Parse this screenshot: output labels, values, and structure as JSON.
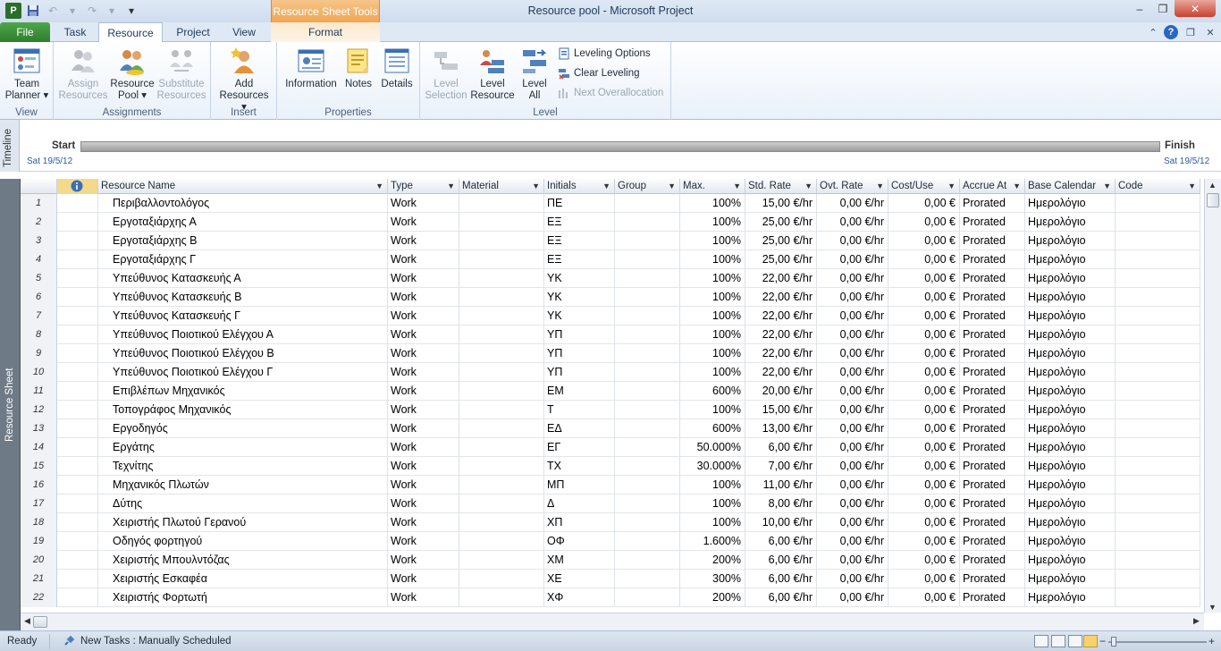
{
  "window": {
    "title": "Resource pool  -  Microsoft Project",
    "context_tab_header": "Resource Sheet Tools",
    "qat_logo": "P",
    "controls": {
      "minimize": "–",
      "maximize": "❐",
      "close": "✕"
    }
  },
  "tabs": {
    "file": "File",
    "task": "Task",
    "resource": "Resource",
    "project": "Project",
    "view": "View",
    "format": "Format"
  },
  "ribbon": {
    "groups": {
      "view": "View",
      "assignments": "Assignments",
      "insert": "Insert",
      "properties": "Properties",
      "level": "Level"
    },
    "buttons": {
      "team_planner_1": "Team",
      "team_planner_2": "Planner ▾",
      "assign_1": "Assign",
      "assign_2": "Resources",
      "resource_pool_1": "Resource",
      "resource_pool_2": "Pool ▾",
      "substitute_1": "Substitute",
      "substitute_2": "Resources",
      "add_1": "Add",
      "add_2": "Resources ▾",
      "information": "Information",
      "notes": "Notes",
      "details": "Details",
      "level_selection_1": "Level",
      "level_selection_2": "Selection",
      "level_resource_1": "Level",
      "level_resource_2": "Resource",
      "level_all_1": "Level",
      "level_all_2": "All",
      "leveling_options": "Leveling Options",
      "clear_leveling": "Clear Leveling",
      "next_overallocation": "Next Overallocation"
    }
  },
  "timeline": {
    "label": "Timeline",
    "start": "Start",
    "start_date": "Sat 19/5/12",
    "finish": "Finish",
    "finish_date": "Sat 19/5/12"
  },
  "sheet": {
    "label": "Resource Sheet",
    "headers": {
      "name": "Resource Name",
      "type": "Type",
      "material": "Material",
      "initials": "Initials",
      "group": "Group",
      "max": "Max.",
      "std_rate": "Std. Rate",
      "ovt_rate": "Ovt. Rate",
      "cost_use": "Cost/Use",
      "accrue_at": "Accrue At",
      "base_calendar": "Base Calendar",
      "code": "Code"
    },
    "rows": [
      {
        "id": "1",
        "name": "Περιβαλλοντολόγος",
        "type": "Work",
        "material": "",
        "initials": "ΠΕ",
        "group": "",
        "max": "100%",
        "std_rate": "15,00 €/hr",
        "ovt_rate": "0,00 €/hr",
        "cost_use": "0,00 €",
        "accrue": "Prorated",
        "calendar": "Ημερολόγιο",
        "code": ""
      },
      {
        "id": "2",
        "name": "Εργοταξιάρχης Α",
        "type": "Work",
        "material": "",
        "initials": "ΕΞ",
        "group": "",
        "max": "100%",
        "std_rate": "25,00 €/hr",
        "ovt_rate": "0,00 €/hr",
        "cost_use": "0,00 €",
        "accrue": "Prorated",
        "calendar": "Ημερολόγιο",
        "code": ""
      },
      {
        "id": "3",
        "name": "Εργοταξιάρχης Β",
        "type": "Work",
        "material": "",
        "initials": "ΕΞ",
        "group": "",
        "max": "100%",
        "std_rate": "25,00 €/hr",
        "ovt_rate": "0,00 €/hr",
        "cost_use": "0,00 €",
        "accrue": "Prorated",
        "calendar": "Ημερολόγιο",
        "code": ""
      },
      {
        "id": "4",
        "name": "Εργοταξιάρχης Γ",
        "type": "Work",
        "material": "",
        "initials": "ΕΞ",
        "group": "",
        "max": "100%",
        "std_rate": "25,00 €/hr",
        "ovt_rate": "0,00 €/hr",
        "cost_use": "0,00 €",
        "accrue": "Prorated",
        "calendar": "Ημερολόγιο",
        "code": ""
      },
      {
        "id": "5",
        "name": "Υπεύθυνος Κατασκευής Α",
        "type": "Work",
        "material": "",
        "initials": "ΥΚ",
        "group": "",
        "max": "100%",
        "std_rate": "22,00 €/hr",
        "ovt_rate": "0,00 €/hr",
        "cost_use": "0,00 €",
        "accrue": "Prorated",
        "calendar": "Ημερολόγιο",
        "code": ""
      },
      {
        "id": "6",
        "name": "Υπεύθυνος Κατασκευής Β",
        "type": "Work",
        "material": "",
        "initials": "ΥΚ",
        "group": "",
        "max": "100%",
        "std_rate": "22,00 €/hr",
        "ovt_rate": "0,00 €/hr",
        "cost_use": "0,00 €",
        "accrue": "Prorated",
        "calendar": "Ημερολόγιο",
        "code": ""
      },
      {
        "id": "7",
        "name": "Υπεύθυνος Κατασκευής Γ",
        "type": "Work",
        "material": "",
        "initials": "ΥΚ",
        "group": "",
        "max": "100%",
        "std_rate": "22,00 €/hr",
        "ovt_rate": "0,00 €/hr",
        "cost_use": "0,00 €",
        "accrue": "Prorated",
        "calendar": "Ημερολόγιο",
        "code": ""
      },
      {
        "id": "8",
        "name": "Υπεύθυνος Ποιοτικού Ελέγχου Α",
        "type": "Work",
        "material": "",
        "initials": "ΥΠ",
        "group": "",
        "max": "100%",
        "std_rate": "22,00 €/hr",
        "ovt_rate": "0,00 €/hr",
        "cost_use": "0,00 €",
        "accrue": "Prorated",
        "calendar": "Ημερολόγιο",
        "code": ""
      },
      {
        "id": "9",
        "name": "Υπεύθυνος Ποιοτικού Ελέγχου Β",
        "type": "Work",
        "material": "",
        "initials": "ΥΠ",
        "group": "",
        "max": "100%",
        "std_rate": "22,00 €/hr",
        "ovt_rate": "0,00 €/hr",
        "cost_use": "0,00 €",
        "accrue": "Prorated",
        "calendar": "Ημερολόγιο",
        "code": ""
      },
      {
        "id": "10",
        "name": "Υπεύθυνος Ποιοτικού Ελέγχου Γ",
        "type": "Work",
        "material": "",
        "initials": "ΥΠ",
        "group": "",
        "max": "100%",
        "std_rate": "22,00 €/hr",
        "ovt_rate": "0,00 €/hr",
        "cost_use": "0,00 €",
        "accrue": "Prorated",
        "calendar": "Ημερολόγιο",
        "code": ""
      },
      {
        "id": "11",
        "name": "Επιβλέπων Μηχανικός",
        "type": "Work",
        "material": "",
        "initials": "ΕΜ",
        "group": "",
        "max": "600%",
        "std_rate": "20,00 €/hr",
        "ovt_rate": "0,00 €/hr",
        "cost_use": "0,00 €",
        "accrue": "Prorated",
        "calendar": "Ημερολόγιο",
        "code": ""
      },
      {
        "id": "12",
        "name": "Τοπογράφος Μηχανικός",
        "type": "Work",
        "material": "",
        "initials": "Τ",
        "group": "",
        "max": "100%",
        "std_rate": "15,00 €/hr",
        "ovt_rate": "0,00 €/hr",
        "cost_use": "0,00 €",
        "accrue": "Prorated",
        "calendar": "Ημερολόγιο",
        "code": ""
      },
      {
        "id": "13",
        "name": "Εργοδηγός",
        "type": "Work",
        "material": "",
        "initials": "ΕΔ",
        "group": "",
        "max": "600%",
        "std_rate": "13,00 €/hr",
        "ovt_rate": "0,00 €/hr",
        "cost_use": "0,00 €",
        "accrue": "Prorated",
        "calendar": "Ημερολόγιο",
        "code": ""
      },
      {
        "id": "14",
        "name": "Εργάτης",
        "type": "Work",
        "material": "",
        "initials": "ΕΓ",
        "group": "",
        "max": "50.000%",
        "std_rate": "6,00 €/hr",
        "ovt_rate": "0,00 €/hr",
        "cost_use": "0,00 €",
        "accrue": "Prorated",
        "calendar": "Ημερολόγιο",
        "code": ""
      },
      {
        "id": "15",
        "name": "Τεχνίτης",
        "type": "Work",
        "material": "",
        "initials": "ΤΧ",
        "group": "",
        "max": "30.000%",
        "std_rate": "7,00 €/hr",
        "ovt_rate": "0,00 €/hr",
        "cost_use": "0,00 €",
        "accrue": "Prorated",
        "calendar": "Ημερολόγιο",
        "code": ""
      },
      {
        "id": "16",
        "name": "Μηχανικός Πλωτών",
        "type": "Work",
        "material": "",
        "initials": "ΜΠ",
        "group": "",
        "max": "100%",
        "std_rate": "11,00 €/hr",
        "ovt_rate": "0,00 €/hr",
        "cost_use": "0,00 €",
        "accrue": "Prorated",
        "calendar": "Ημερολόγιο",
        "code": ""
      },
      {
        "id": "17",
        "name": "Δύτης",
        "type": "Work",
        "material": "",
        "initials": "Δ",
        "group": "",
        "max": "100%",
        "std_rate": "8,00 €/hr",
        "ovt_rate": "0,00 €/hr",
        "cost_use": "0,00 €",
        "accrue": "Prorated",
        "calendar": "Ημερολόγιο",
        "code": ""
      },
      {
        "id": "18",
        "name": "Χειριστής Πλωτού Γερανού",
        "type": "Work",
        "material": "",
        "initials": "ΧΠ",
        "group": "",
        "max": "100%",
        "std_rate": "10,00 €/hr",
        "ovt_rate": "0,00 €/hr",
        "cost_use": "0,00 €",
        "accrue": "Prorated",
        "calendar": "Ημερολόγιο",
        "code": ""
      },
      {
        "id": "19",
        "name": "Οδηγός φορτηγού",
        "type": "Work",
        "material": "",
        "initials": "ΟΦ",
        "group": "",
        "max": "1.600%",
        "std_rate": "6,00 €/hr",
        "ovt_rate": "0,00 €/hr",
        "cost_use": "0,00 €",
        "accrue": "Prorated",
        "calendar": "Ημερολόγιο",
        "code": ""
      },
      {
        "id": "20",
        "name": "Χειριστής Μπουλντόζας",
        "type": "Work",
        "material": "",
        "initials": "ΧΜ",
        "group": "",
        "max": "200%",
        "std_rate": "6,00 €/hr",
        "ovt_rate": "0,00 €/hr",
        "cost_use": "0,00 €",
        "accrue": "Prorated",
        "calendar": "Ημερολόγιο",
        "code": ""
      },
      {
        "id": "21",
        "name": "Χειριστής Εσκαφέα",
        "type": "Work",
        "material": "",
        "initials": "ΧΕ",
        "group": "",
        "max": "300%",
        "std_rate": "6,00 €/hr",
        "ovt_rate": "0,00 €/hr",
        "cost_use": "0,00 €",
        "accrue": "Prorated",
        "calendar": "Ημερολόγιο",
        "code": ""
      },
      {
        "id": "22",
        "name": "Χειριστής Φορτωτή",
        "type": "Work",
        "material": "",
        "initials": "ΧΦ",
        "group": "",
        "max": "200%",
        "std_rate": "6,00 €/hr",
        "ovt_rate": "0,00 €/hr",
        "cost_use": "0,00 €",
        "accrue": "Prorated",
        "calendar": "Ημερολόγιο",
        "code": ""
      }
    ]
  },
  "statusbar": {
    "ready": "Ready",
    "new_tasks": "New Tasks : Manually Scheduled",
    "zoom_minus": "−",
    "zoom_plus": "+"
  },
  "icons": {
    "info_header": "info-icon",
    "save": "save-icon",
    "undo": "undo-icon",
    "redo": "redo-icon"
  },
  "colors": {
    "file_tab": "#2e7d2c",
    "context_tab": "#eea653",
    "sheet_strip": "#6e7b87"
  }
}
